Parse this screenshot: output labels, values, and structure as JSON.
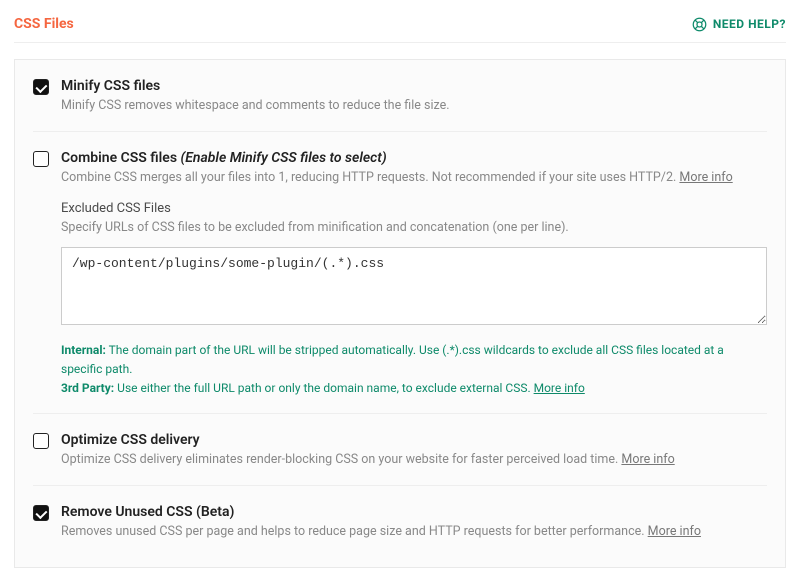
{
  "header": {
    "title": "CSS Files",
    "help_label": "NEED HELP?"
  },
  "more_info_label": "More info",
  "options": {
    "minify": {
      "checked": true,
      "title": "Minify CSS files",
      "desc": "Minify CSS removes whitespace and comments to reduce the file size."
    },
    "combine": {
      "checked": false,
      "title": "Combine CSS files",
      "title_hint": "(Enable Minify CSS files to select)",
      "desc": "Combine CSS merges all your files into 1, reducing HTTP requests. Not recommended if your site uses HTTP/2."
    },
    "excluded": {
      "title": "Excluded CSS Files",
      "desc": "Specify URLs of CSS files to be excluded from minification and concatenation (one per line).",
      "value": "/wp-content/plugins/some-plugin/(.*).css",
      "note_internal_label": "Internal:",
      "note_internal_text": "The domain part of the URL will be stripped automatically. Use (.*).css wildcards to exclude all CSS files located at a specific path.",
      "note_3rdparty_label": "3rd Party:",
      "note_3rdparty_text": "Use either the full URL path or only the domain name, to exclude external CSS."
    },
    "optimize": {
      "checked": false,
      "title": "Optimize CSS delivery",
      "desc": "Optimize CSS delivery eliminates render-blocking CSS on your website for faster perceived load time."
    },
    "remove_unused": {
      "checked": true,
      "title": "Remove Unused CSS (Beta)",
      "desc": "Removes unused CSS per page and helps to reduce page size and HTTP requests for better performance."
    }
  }
}
